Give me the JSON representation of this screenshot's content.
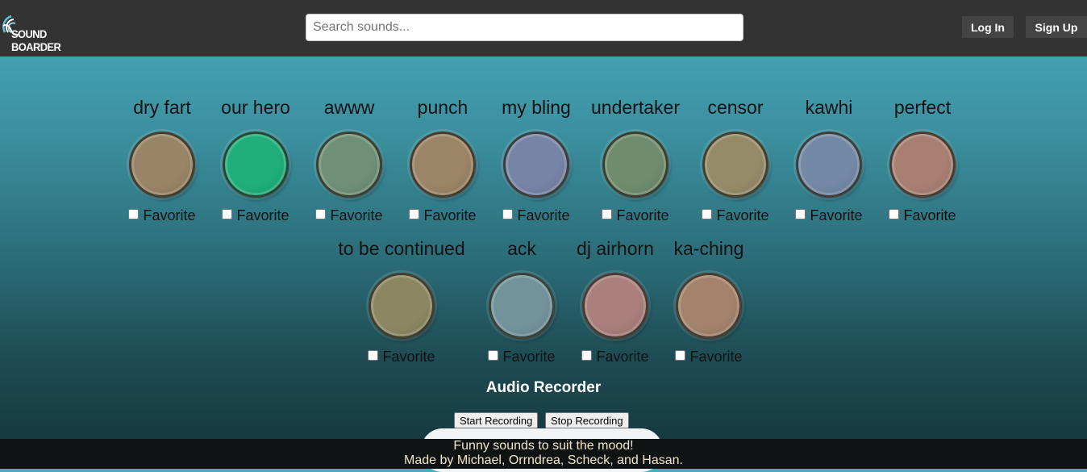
{
  "brand": {
    "name": "SOUND BOARDER",
    "logo_icon": "sound-wave-icon"
  },
  "search": {
    "placeholder": "Search sounds..."
  },
  "nav": {
    "login_label": "Log In",
    "signup_label": "Sign Up"
  },
  "sounds_row1": [
    {
      "label": "dry fart",
      "color": "#9a8467",
      "favorite_label": "Favorite",
      "favorite": false
    },
    {
      "label": "our hero",
      "color": "#1fae7c",
      "favorite_label": "Favorite",
      "favorite": false
    },
    {
      "label": "awww",
      "color": "#6f8f77",
      "favorite_label": "Favorite",
      "favorite": false
    },
    {
      "label": "punch",
      "color": "#9c8466",
      "favorite_label": "Favorite",
      "favorite": false
    },
    {
      "label": "my bling",
      "color": "#7784a6",
      "favorite_label": "Favorite",
      "favorite": false
    },
    {
      "label": "undertaker",
      "color": "#6f8c6c",
      "favorite_label": "Favorite",
      "favorite": false
    },
    {
      "label": "censor",
      "color": "#958b69",
      "favorite_label": "Favorite",
      "favorite": false
    },
    {
      "label": "kawhi",
      "color": "#7489a5",
      "favorite_label": "Favorite",
      "favorite": false
    },
    {
      "label": "perfect",
      "color": "#a97f72",
      "favorite_label": "Favorite",
      "favorite": false
    }
  ],
  "sounds_row2": [
    {
      "label": "to be continued",
      "color": "#8c8763",
      "favorite_label": "Favorite",
      "favorite": false
    },
    {
      "label": "ack",
      "color": "#73939c",
      "favorite_label": "Favorite",
      "favorite": false
    },
    {
      "label": "dj airhorn",
      "color": "#aa7f7c",
      "favorite_label": "Favorite",
      "favorite": false
    },
    {
      "label": "ka-ching",
      "color": "#a4836d",
      "favorite_label": "Favorite",
      "favorite": false
    }
  ],
  "recorder": {
    "title": "Audio Recorder",
    "start_label": "Start Recording",
    "stop_label": "Stop Recording"
  },
  "footer": {
    "line1": "Funny sounds to suit the mood!",
    "line2": "Made by Michael, Orrndrea, Scheck, and Hasan."
  }
}
